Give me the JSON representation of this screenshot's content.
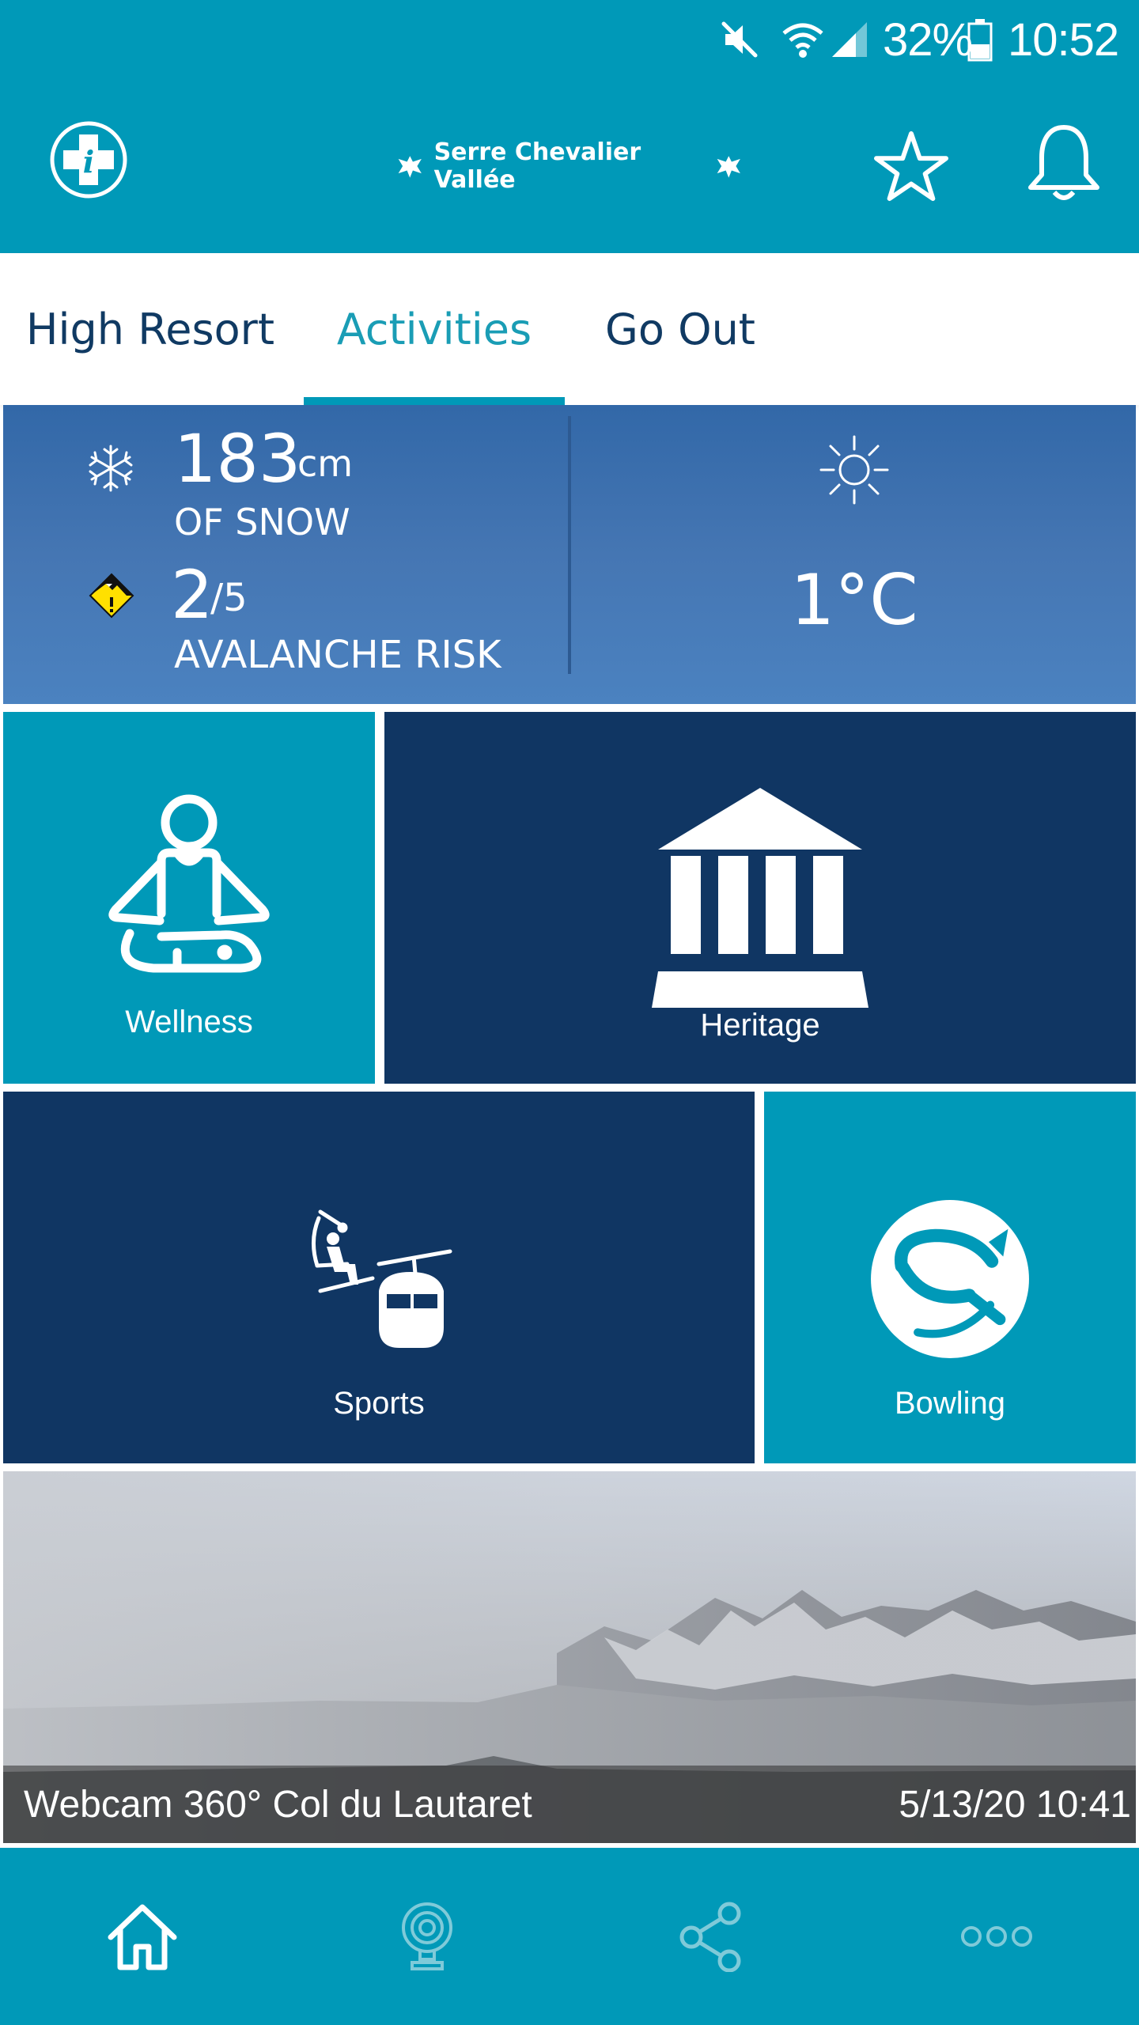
{
  "status_bar": {
    "battery": "32%",
    "time": "10:52"
  },
  "header": {
    "brand": "Serre Chevalier Vallée",
    "icons": [
      "info-cross-icon",
      "star-icon",
      "bell-icon"
    ]
  },
  "tabs": [
    {
      "label": "High Resort",
      "active": false
    },
    {
      "label": "Activities",
      "active": true
    },
    {
      "label": "Go Out",
      "active": false
    }
  ],
  "conditions": {
    "snow_value": "183",
    "snow_unit": "cm",
    "snow_label": "OF SNOW",
    "avalanche_value": "2",
    "avalanche_max": "/5",
    "avalanche_label": "AVALANCHE RISK",
    "temperature": "1°C",
    "weather_icon": "sun-icon"
  },
  "tiles": [
    {
      "label": "Wellness",
      "icon": "meditation-icon"
    },
    {
      "label": "Heritage",
      "icon": "museum-icon"
    },
    {
      "label": "Sports",
      "icon": "ski-lift-icon"
    },
    {
      "label": "Bowling",
      "icon": "bowling-ball-icon"
    }
  ],
  "webcam": {
    "title": "Webcam 360° Col du Lautaret",
    "timestamp": "5/13/20 10:41"
  },
  "bottom_nav": [
    {
      "icon": "home-icon",
      "active": true
    },
    {
      "icon": "webcam-icon",
      "active": false
    },
    {
      "icon": "share-icon",
      "active": false
    },
    {
      "icon": "more-icon",
      "active": false
    }
  ],
  "colors": {
    "primary": "#0099b8",
    "dark_blue": "#103663",
    "tab_text": "#103a63",
    "active_tab": "#1a9db5"
  }
}
